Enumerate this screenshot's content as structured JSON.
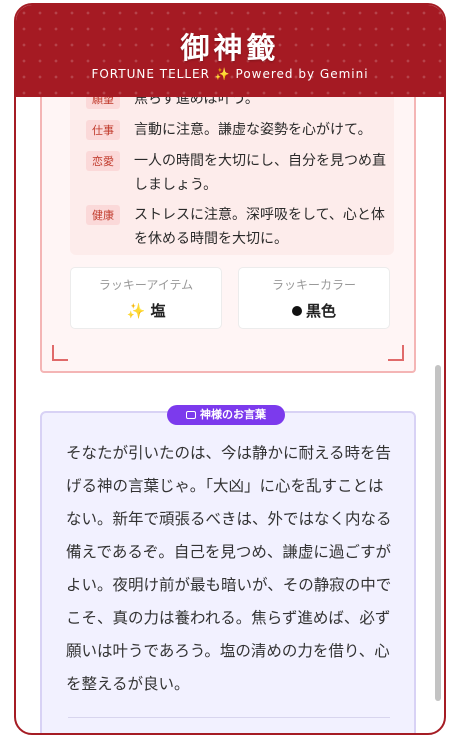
{
  "header": {
    "title": "御神籤",
    "subtitle": "FORTUNE TELLER ✨ Powered by Gemini"
  },
  "fortune": {
    "items": [
      {
        "category": "願望",
        "text": "焦らず進めば叶う。"
      },
      {
        "category": "仕事",
        "text": "言動に注意。謙虚な姿勢を心がけて。"
      },
      {
        "category": "恋愛",
        "text": "一人の時間を大切にし、自分を見つめ直しましょう。"
      },
      {
        "category": "健康",
        "text": "ストレスに注意。深呼吸をして、心と体を休める時間を大切に。"
      }
    ],
    "lucky_item": {
      "label": "ラッキーアイテム",
      "icon": "sparkle-icon",
      "value": "塩"
    },
    "lucky_color": {
      "label": "ラッキーカラー",
      "color": "#111111",
      "value": "黒色"
    }
  },
  "god_words": {
    "badge": "神様のお言葉",
    "message": "そなたが引いたのは、今は静かに耐える時を告げる神の言葉じゃ。「大凶」に心を乱すことはない。新年で頑張るべきは、外ではなく内なる備えであるぞ。自己を見つめ、謙虚に過ごすがよい。夜明け前が最も暗いが、その静寂の中でこそ、真の力は養われる。焦らず進めば、必ず願いは叶うであろう。塩の清めの力を借り、心を整えるが良い。"
  },
  "colors": {
    "header_red": "#a51a23",
    "badge_purple": "#7c3aed",
    "tag_red": "#c0392b"
  }
}
